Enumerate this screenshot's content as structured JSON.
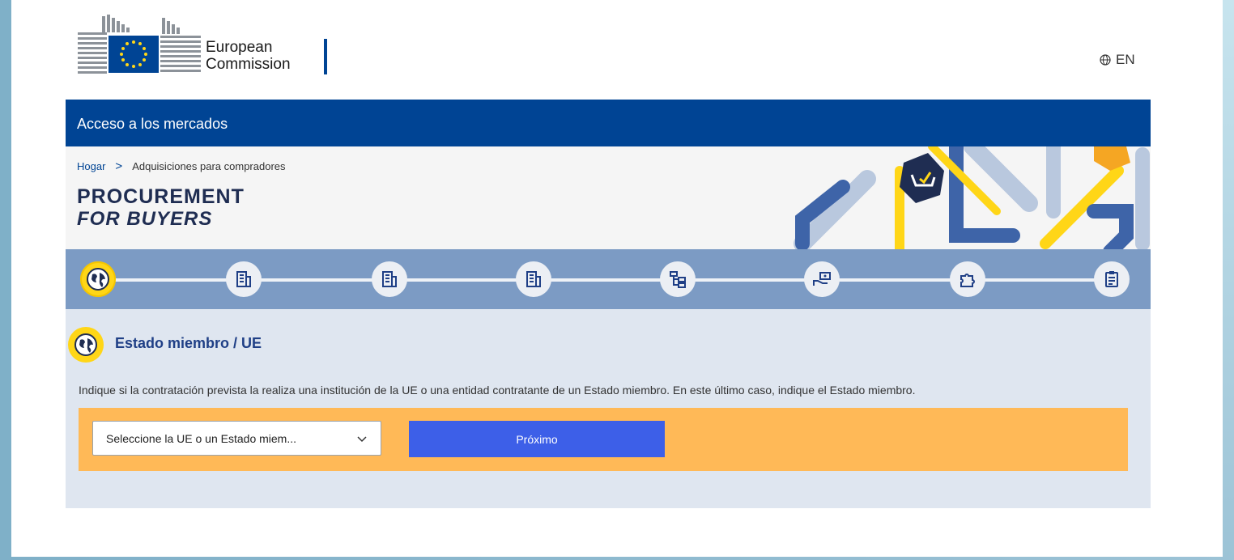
{
  "header": {
    "org_line1": "European",
    "org_line2": "Commission",
    "language": "EN",
    "globe_icon": "globe-icon"
  },
  "topbar": {
    "title": "Acceso a los mercados"
  },
  "breadcrumb": {
    "home": "Hogar",
    "separator": ">",
    "current": "Adquisiciones para compradores"
  },
  "banner": {
    "title_line1": "PROCUREMENT",
    "title_line2_prefix": "FOR ",
    "title_line2_bold": "BUYERS"
  },
  "steps": [
    {
      "icon": "globe-icon",
      "active": true
    },
    {
      "icon": "building-icon",
      "active": false
    },
    {
      "icon": "building-icon",
      "active": false
    },
    {
      "icon": "building-icon",
      "active": false
    },
    {
      "icon": "flowchart-icon",
      "active": false
    },
    {
      "icon": "money-hand-icon",
      "active": false
    },
    {
      "icon": "puzzle-icon",
      "active": false
    },
    {
      "icon": "clipboard-icon",
      "active": false
    }
  ],
  "section": {
    "title": "Estado miembro / UE",
    "instruction": "Indique si la contratación prevista la realiza una institución de la UE o una entidad contratante de un Estado miembro. En este último caso, indique el Estado miembro.",
    "select_placeholder": "Seleccione la UE o un Estado miem...",
    "next_button": "Próximo"
  },
  "colors": {
    "ec_blue": "#004494",
    "step_bar": "#7c9bc4",
    "active_yellow": "#ffd617",
    "form_orange": "#ffb957",
    "button_blue": "#3d5fe8",
    "content_bg": "#dfe6f0"
  }
}
